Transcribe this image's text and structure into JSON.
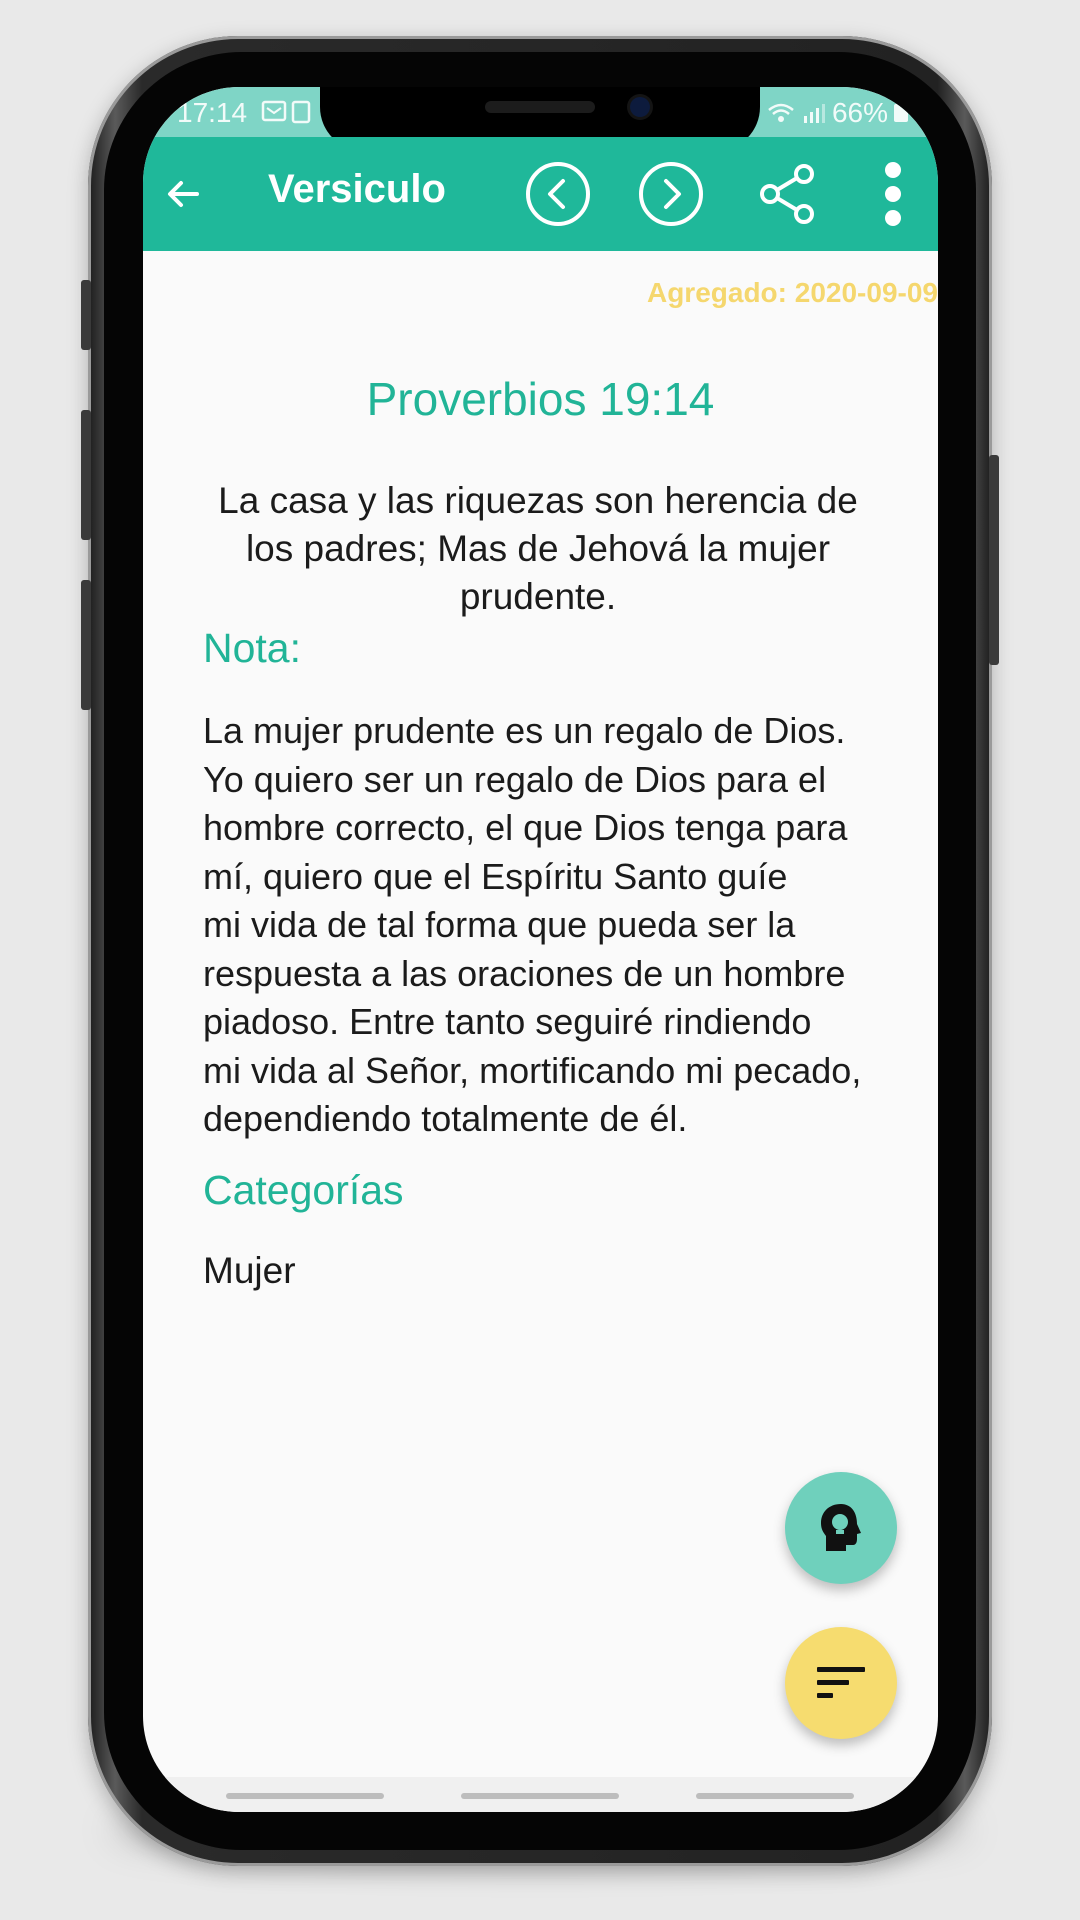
{
  "status_bar": {
    "time": "17:14",
    "battery": "66%"
  },
  "app_bar": {
    "title": "Versiculo",
    "icons": [
      "back-arrow-icon",
      "previous-circle-icon",
      "next-circle-icon",
      "share-icon",
      "more-vert-icon"
    ]
  },
  "verse": {
    "added_label": "Agregado: 2020-09-09",
    "reference": "Proverbios 19:14",
    "text": "La casa y las riquezas son herencia de los padres; Mas de Jehová la mujer prudente."
  },
  "note": {
    "heading": "Nota:",
    "text": "La mujer prudente es un regalo de Dios.\nYo quiero ser un regalo de Dios para el\nhombre correcto, el que Dios tenga para\nmí, quiero que el Espíritu Santo guíe\nmi vida de tal forma que pueda ser la\nrespuesta a las oraciones de un hombre\npiadoso. Entre tanto seguiré rindiendo\nmi vida al Señor, mortificando mi pecado,\ndependiendo totalmente de él."
  },
  "categories": {
    "heading": "Categorías",
    "items": [
      "Mujer"
    ]
  },
  "fabs": {
    "top_icon": "lightbulb-head-icon",
    "bottom_icon": "sort-lines-icon"
  },
  "colors": {
    "primary": "#1fb89a",
    "accent_text": "#21b497",
    "date_yellow": "#f5d76e",
    "fab_teal": "#6fd0bc",
    "fab_yellow": "#f6dc6f"
  }
}
